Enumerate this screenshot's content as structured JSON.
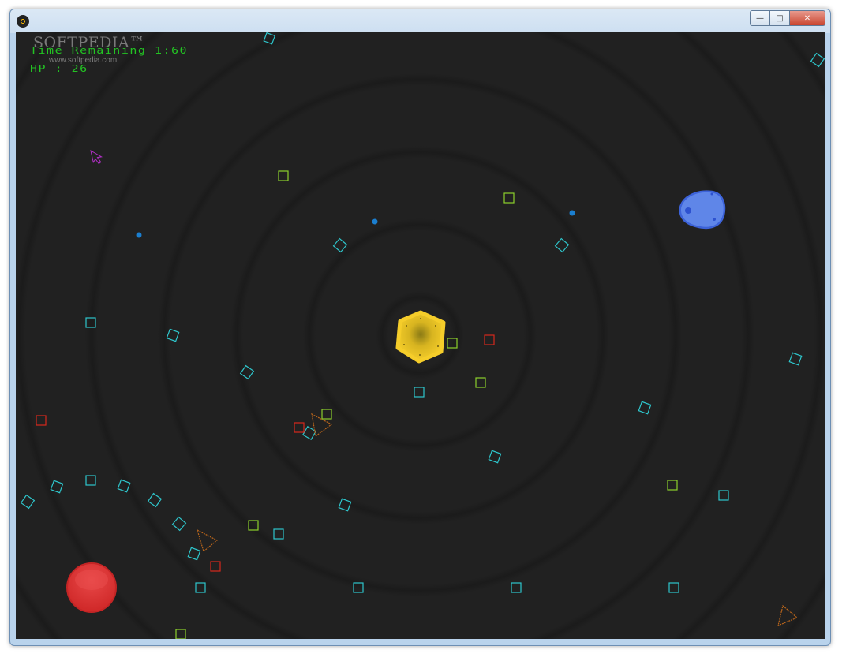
{
  "window": {
    "icon": "radiation-icon"
  },
  "caption_buttons": {
    "minimize": "—",
    "maximize": "□",
    "close": "✕"
  },
  "watermark": {
    "name": "SOFTPEDIA™",
    "url": "www.softpedia.com"
  },
  "hud": {
    "time_remaining": "Time Remaining 1:60",
    "hp": "HP : 26"
  },
  "colors": {
    "background": "#1f1f1f",
    "hud_text": "#23c323",
    "cyan_square": "#2ec6cc",
    "green_square": "#8ccf2c",
    "red_square": "#d6281c",
    "blue_dot": "#1b7fd0",
    "player": "#f2c924",
    "enemy_blob": "#5f86e8",
    "red_orb": "#e53b3b",
    "triangle": "#b9651b",
    "cursor": "#b330c8"
  }
}
